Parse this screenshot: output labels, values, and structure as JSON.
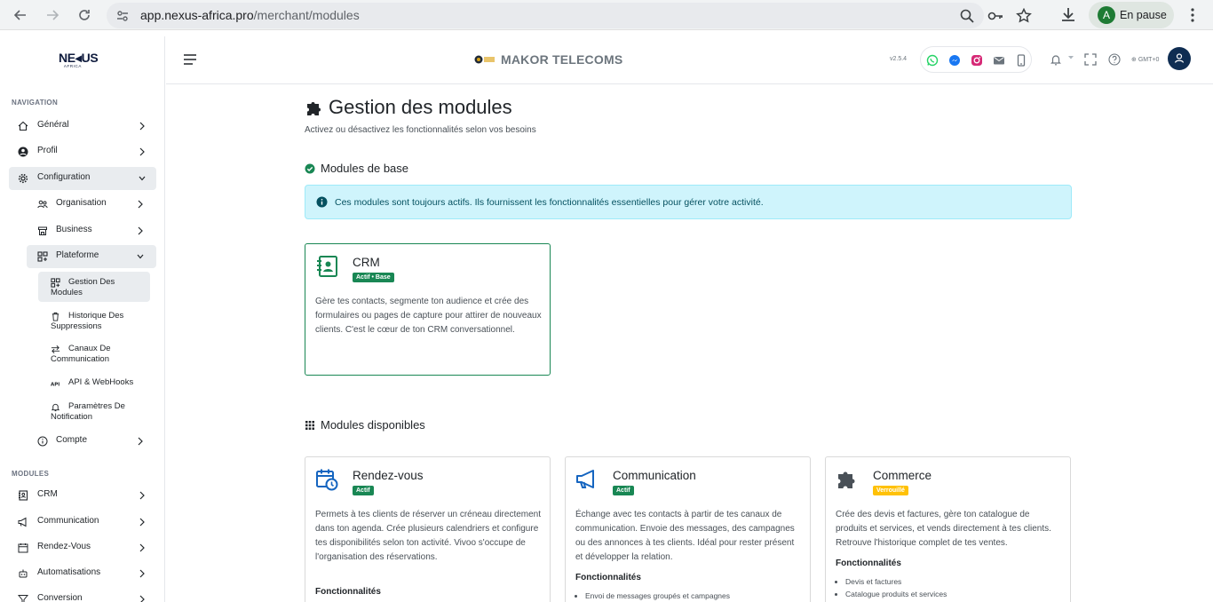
{
  "browser": {
    "url_host": "app.nexus-africa.pro",
    "url_path": "/merchant/modules",
    "profile_initial": "A",
    "profile_status": "En pause"
  },
  "sidebar": {
    "logo": "NE◂US",
    "logo_sub": "AFRICA",
    "nav_heading": "NAVIGATION",
    "items": {
      "general": "Général",
      "profil": "Profil",
      "configuration": "Configuration",
      "organisation": "Organisation",
      "business": "Business",
      "plateforme": "Plateforme",
      "gestion_modules": "Gestion Des Modules",
      "historique": "Historique Des Suppressions",
      "canaux": "Canaux De Communication",
      "api": "API & WebHooks",
      "parametres": "Paramètres De Notification",
      "compte": "Compte"
    },
    "modules_heading": "MODULES",
    "modules": {
      "crm": "CRM",
      "communication": "Communication",
      "rdv": "Rendez-Vous",
      "automatisations": "Automatisations",
      "conversion": "Conversion"
    }
  },
  "topbar": {
    "brand": "MAKOR TELECOMS",
    "version": "v2.5.4",
    "timezone": "GMT+0"
  },
  "page": {
    "title": "Gestion des modules",
    "subtitle": "Activez ou désactivez les fonctionnalités selon vos besoins",
    "base_title": "Modules de base",
    "alert": "Ces modules sont toujours actifs. Ils fournissent les fonctionnalités essentielles pour gérer votre activité.",
    "available_title": "Modules disponibles"
  },
  "cards": {
    "crm": {
      "title": "CRM",
      "badge": "Actif • Base",
      "desc": "Gère tes contacts, segmente ton audience et crée des formulaires ou pages de capture pour attirer de nouveaux clients. C'est le cœur de ton CRM conversationnel."
    },
    "rdv": {
      "title": "Rendez-vous",
      "badge": "Actif",
      "desc": "Permets à tes clients de réserver un créneau directement dans ton agenda. Crée plusieurs calendriers et configure tes disponibilités selon ton activité. Vivoo s'occupe de l'organisation des réservations.",
      "feat_label": "Fonctionnalités"
    },
    "communication": {
      "title": "Communication",
      "badge": "Actif",
      "desc": "Échange avec tes contacts à partir de tes canaux de communication. Envoie des messages, des campagnes ou des annonces à tes clients. Idéal pour rester présent et développer la relation.",
      "feat_label": "Fonctionnalités",
      "feat_1": "Envoi de messages groupés et campagnes"
    },
    "commerce": {
      "title": "Commerce",
      "badge": "Verrouillé",
      "desc": "Crée des devis et factures, gère ton catalogue de produits et services, et vends directement à tes clients. Retrouve l'historique complet de tes ventes.",
      "feat_label": "Fonctionnalités",
      "feat_1": "Devis et factures",
      "feat_2": "Catalogue produits et services"
    }
  },
  "colors": {
    "success": "#198754",
    "warning": "#ffc107",
    "info_bg": "#cff4fc",
    "primary": "#1565c0"
  }
}
